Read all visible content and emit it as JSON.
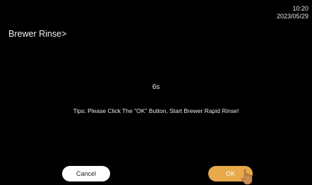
{
  "status_bar": {
    "time": "10:20",
    "date": "2023/05/29"
  },
  "header": {
    "title": "Brewer Rinse>"
  },
  "main": {
    "countdown": "6s",
    "tips": "Tips: Please Click The \"OK\" Button, Start Brewer Rapid Rinse!"
  },
  "buttons": {
    "cancel_label": "Cancel",
    "ok_label": "OK"
  },
  "colors": {
    "background": "#000000",
    "ok_button": "#e7a94a",
    "cancel_button": "#ffffff"
  },
  "icons": {
    "pointer": "hand-pointer-icon"
  }
}
